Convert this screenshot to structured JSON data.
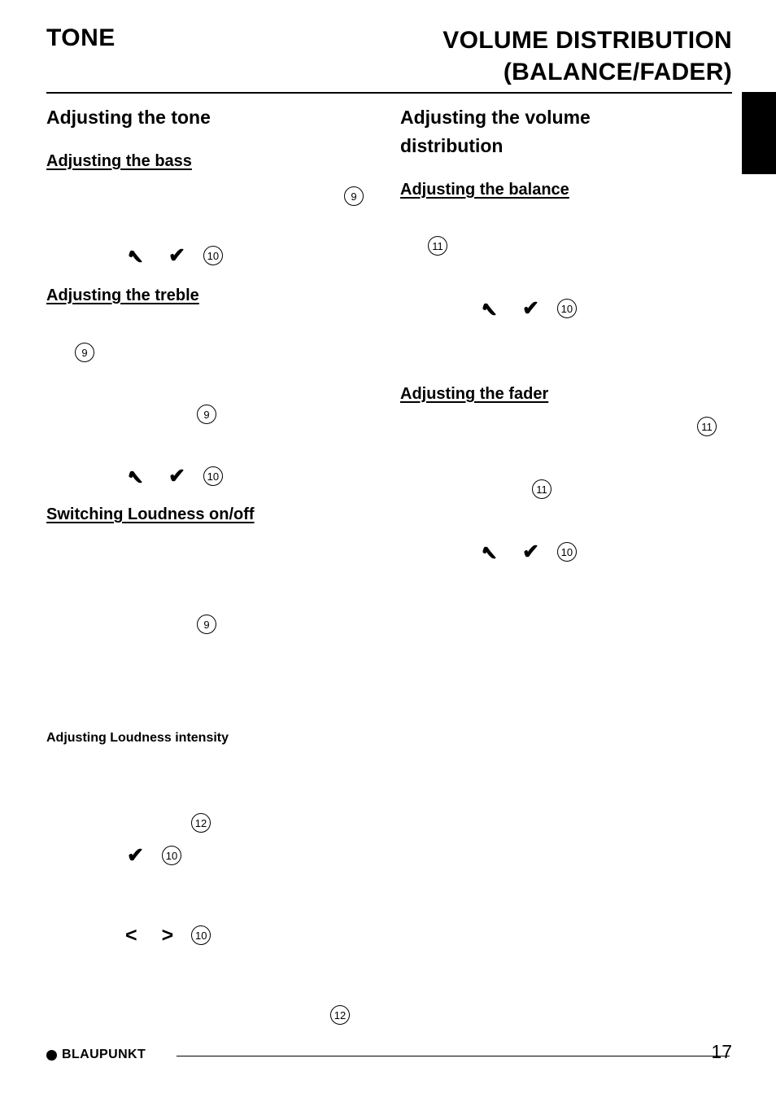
{
  "header": {
    "title_left": "TONE",
    "title_right_line1": "VOLUME DISTRIBUTION",
    "title_right_line2": "(BALANCE/FADER)"
  },
  "left_column": {
    "section_title": "Adjusting the tone",
    "sub_bass": "Adjusting the bass",
    "sub_treble": "Adjusting the treble",
    "sub_loudness": "Switching Loudness on/off",
    "sub_loudness_intensity": "Adjusting Loudness intensity",
    "markers": {
      "bass_ref_9": "9",
      "bass_arrows_10": "10",
      "treble_ref_9a": "9",
      "treble_ref_9b": "9",
      "treble_arrows_10": "10",
      "loudness_ref_9": "9",
      "intensity_ref_12a": "12",
      "intensity_arrow_10a": "10",
      "intensity_arrow_10b": "10",
      "intensity_ref_12b": "12"
    },
    "glyphs": {
      "up": "✔",
      "down": "✔",
      "left": "<",
      "right": ">"
    }
  },
  "right_column": {
    "section_title_line1": "Adjusting the volume",
    "section_title_line2": "distribution",
    "sub_balance": "Adjusting the balance",
    "sub_fader": "Adjusting the fader",
    "markers": {
      "balance_ref_11": "11",
      "balance_arrows_10": "10",
      "fader_ref_11a": "11",
      "fader_ref_11b": "11",
      "fader_arrows_10": "10"
    }
  },
  "footer": {
    "brand": "BLAUPUNKT",
    "page_number": "17"
  },
  "colors": {
    "text": "#000000",
    "background": "#ffffff",
    "tab": "#000000"
  }
}
